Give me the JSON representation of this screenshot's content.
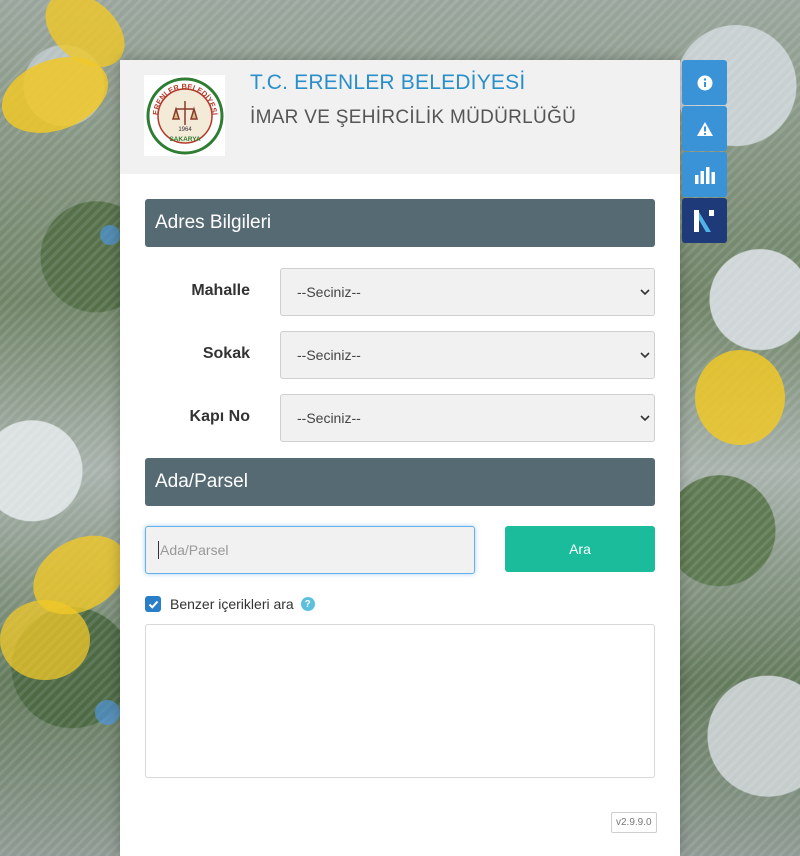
{
  "header": {
    "title": "T.C. ERENLER BELEDİYESİ",
    "subtitle": "İMAR VE ŞEHİRCİLİK MÜDÜRLÜĞÜ",
    "logo_text": "ERENLER BELEDİYESİ",
    "logo_year": "1964",
    "logo_bottom": "SAKARYA"
  },
  "address_section": {
    "title": "Adres Bilgileri",
    "fields": [
      {
        "label": "Mahalle",
        "value": "--Seciniz--"
      },
      {
        "label": "Sokak",
        "value": "--Seciniz--"
      },
      {
        "label": "Kapı No",
        "value": "--Seciniz--"
      }
    ]
  },
  "parcel_section": {
    "title": "Ada/Parsel",
    "input_placeholder": "Ada/Parsel",
    "search_button": "Ara"
  },
  "similar": {
    "label": "Benzer içerikleri ara",
    "checked": true
  },
  "version": "v2.9.9.0",
  "side_buttons": [
    "info-icon",
    "warning-icon",
    "chart-icon",
    "brand-logo-icon"
  ],
  "colors": {
    "title": "#2a8fc9",
    "section_bar": "#566a74",
    "search_button": "#1abc9c",
    "side_button": "#3a93d6",
    "side_button_dark": "#1e3a78",
    "checkbox": "#2a7ec8"
  }
}
